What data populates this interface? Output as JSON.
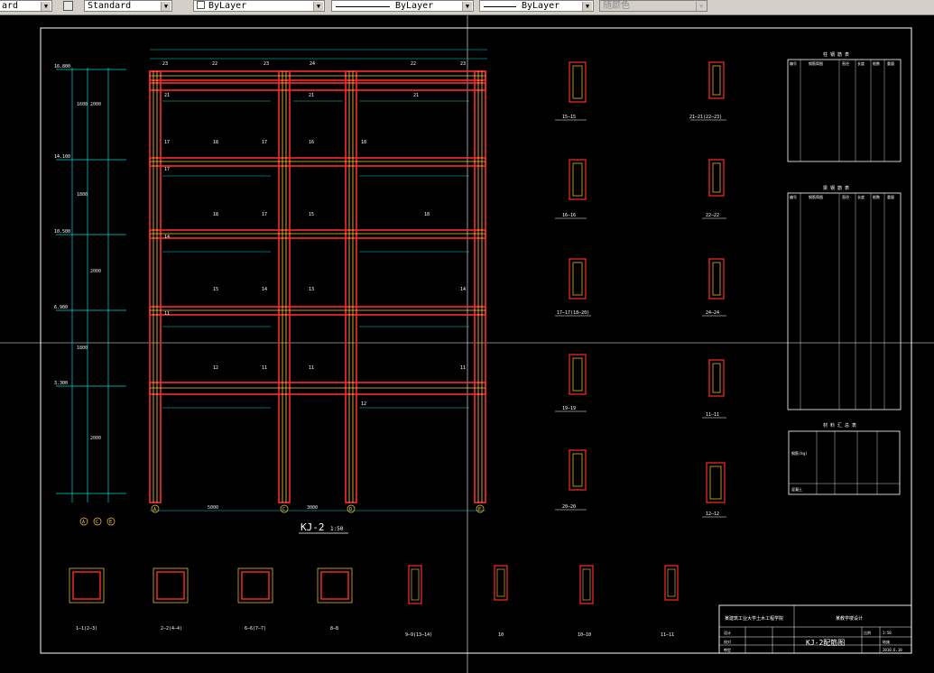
{
  "toolbar": {
    "layer_state_fragment": "ard",
    "text_style": "Standard",
    "layer_color": "ByLayer",
    "linetype": "ByLayer",
    "lineweight": "ByLayer",
    "plot_style": "随颜色"
  },
  "drawing": {
    "frame_title": "KJ-2",
    "frame_scale": "1:50",
    "axis_bubbles": [
      "A",
      "C",
      "D",
      "E"
    ],
    "left_axis_bubbles": [
      "A",
      "C",
      "E"
    ],
    "span_left": "3000",
    "span_mid": "5000",
    "story_heights": [
      "3600",
      "3600",
      "3600",
      "3600",
      "4200"
    ],
    "elevations": [
      "16.800",
      "14.100",
      "10.500",
      "6.900",
      "3.300"
    ],
    "section_labels_right_col1": [
      "15—15",
      "16—16",
      "17—17(18—20)",
      "19—19",
      "20—20"
    ],
    "section_labels_right_col2": [
      "21—21(22—23)",
      "22—22",
      "24—24",
      "11—11",
      "12—12"
    ],
    "section_labels_bottom": [
      "1—1(2—3)",
      "2—2(4—4)",
      "6—6(7—7)",
      "8—8",
      "9—9(13—14)",
      "10",
      "10—10",
      "11—11"
    ],
    "table1_title": "柱 钢 筋 表",
    "table1_headers": [
      "编号",
      "钢筋简图",
      "直径",
      "长度",
      "根数",
      "重量"
    ],
    "table2_title": "梁 钢 筋 表",
    "table2_headers": [
      "编号",
      "钢筋简图",
      "直径",
      "长度",
      "根数",
      "重量"
    ],
    "table3_title": "材 料 汇 总 表",
    "table3_label": "钢筋(kg)",
    "table3_last": "混凝土",
    "title_block": {
      "school": "某建筑工业大学土木工程学院",
      "project": "某教学楼设计",
      "drawing_name": "KJ-2配筋图",
      "sheet_no": "结施",
      "design": "设计",
      "check": "校对",
      "approve": "审定",
      "scale_label": "比例",
      "scale_value": "1:50",
      "date": "2010.6.10"
    }
  },
  "colors": {
    "frame": "#ffffff",
    "beam_column": "#ff2a2a",
    "stirrup": "#ffcc33",
    "dimension": "#00d7d7",
    "background": "#000000"
  }
}
